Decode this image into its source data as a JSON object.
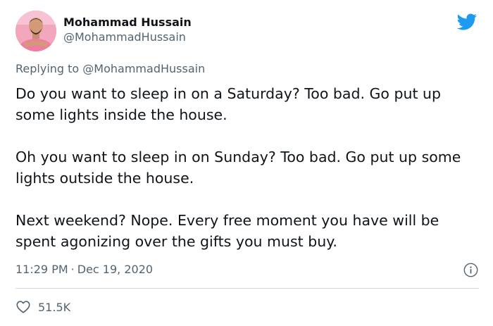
{
  "author": {
    "name": "Mohammad Hussain",
    "handle": "@MohammadHussain"
  },
  "reply": {
    "prefix": "Replying to ",
    "handle": "@MohammadHussain"
  },
  "tweet": {
    "paragraphs": [
      "Do you want to sleep in on a Saturday? Too bad. Go put up some lights inside the house.",
      "Oh you want to sleep in on Sunday? Too bad. Go put up some lights outside the house.",
      "Next weekend? Nope. Every free moment you have will be spent agonizing over the gifts you must buy."
    ]
  },
  "meta": {
    "time": "11:29 PM",
    "separator": "·",
    "date": "Dec 19, 2020"
  },
  "engagement": {
    "likes": "51.5K"
  },
  "icons": {
    "brand": "twitter-bird-icon",
    "info": "info-icon",
    "like": "heart-icon"
  },
  "colors": {
    "brand": "#1d9bf0",
    "text_primary": "#0f1419",
    "text_secondary": "#536471",
    "divider": "#cfd9de"
  }
}
